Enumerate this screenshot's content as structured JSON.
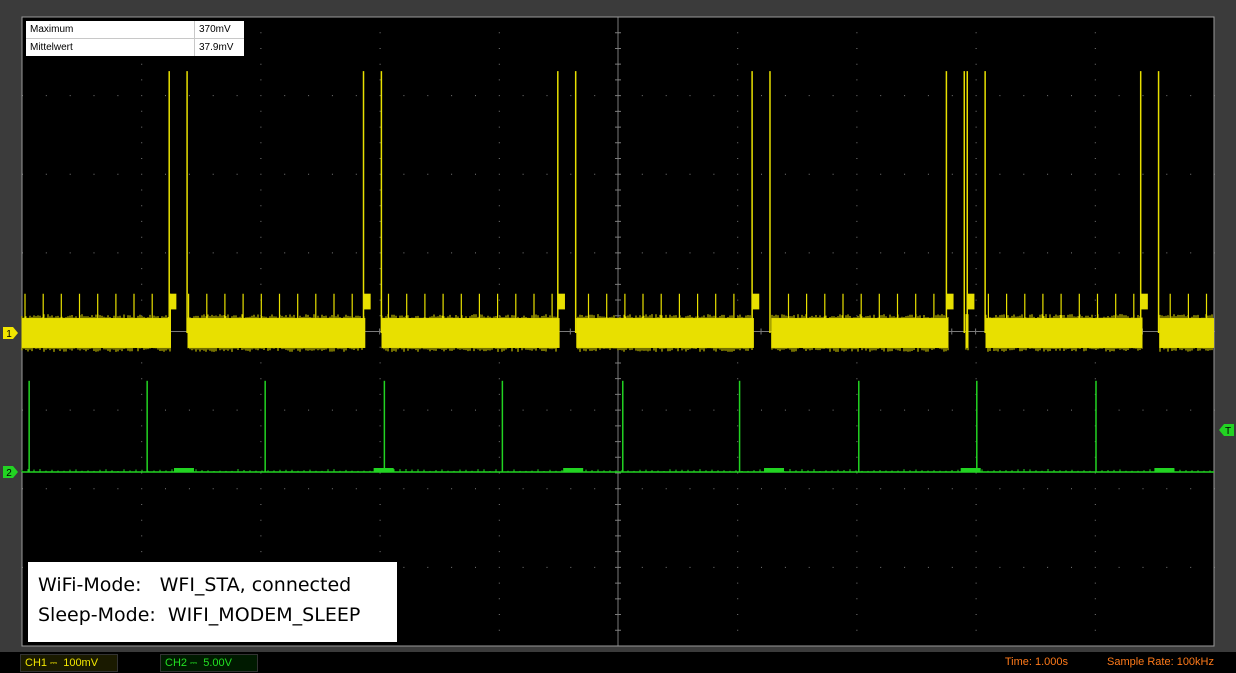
{
  "measurements": [
    {
      "label": "Maximum",
      "value": "370mV"
    },
    {
      "label": "Mittelwert",
      "value": "37.9mV"
    }
  ],
  "note": {
    "line1": "WiFi-Mode:   WFI_STA, connected",
    "line2": "Sleep-Mode:  WIFI_MODEM_SLEEP"
  },
  "status_bar": {
    "ch1_label": "CH1",
    "ch1_coupling": "⎓",
    "ch1_scale": "100mV",
    "ch2_label": "CH2",
    "ch2_coupling": "⎓",
    "ch2_scale": "5.00V",
    "time": "Time: 1.000s",
    "sample_rate": "Sample Rate: 100kHz"
  },
  "markers": {
    "ch1": "1",
    "ch2": "2",
    "trigger": "T"
  },
  "colors": {
    "ch1": "#e8e000",
    "ch2": "#22d322",
    "screen": "#000000",
    "grid": "#7a7a7a",
    "status_orange": "#ff7a1a"
  },
  "chart_data": {
    "type": "line",
    "grid_divisions": {
      "x": 10,
      "y": 8
    },
    "time_per_div_s": 1.0,
    "ch1_mV_per_div": 100,
    "ch2_V_per_div": 5.0,
    "series": [
      {
        "name": "CH1",
        "baseline_mV": 0,
        "noise_band_mV": [
          -19,
          19
        ],
        "small_peak_mV": 50,
        "burst_plateau_mV": 50,
        "burst_peak_mV": 370,
        "small_peak_period_s": 0.1,
        "bursts": [
          {
            "start_s": 2.47,
            "end_s": 2.77
          },
          {
            "start_s": 5.73,
            "end_s": 6.03
          },
          {
            "start_s": 8.99,
            "end_s": 9.29
          },
          {
            "start_s": 12.25,
            "end_s": 12.55
          },
          {
            "start_s": 15.51,
            "end_s": 15.81
          },
          {
            "start_s": 15.86,
            "end_s": 16.16
          },
          {
            "start_s": 18.77,
            "end_s": 19.07
          }
        ],
        "gaps": [
          {
            "start_s": 2.5,
            "end_s": 2.78
          },
          {
            "start_s": 5.76,
            "end_s": 6.04
          },
          {
            "start_s": 9.02,
            "end_s": 9.3
          },
          {
            "start_s": 12.28,
            "end_s": 12.57
          },
          {
            "start_s": 15.54,
            "end_s": 15.83
          },
          {
            "start_s": 15.88,
            "end_s": 16.17
          },
          {
            "start_s": 18.8,
            "end_s": 19.08
          }
        ]
      },
      {
        "name": "CH2",
        "baseline_V": 0,
        "spike_V": 5.8,
        "spikes_s": [
          0.12,
          2.1,
          4.08,
          6.08,
          8.06,
          10.08,
          12.04,
          14.04,
          16.02,
          18.02
        ],
        "small_bumps_s": [
          2.55,
          5.9,
          9.08,
          12.45,
          15.75,
          19.0
        ]
      }
    ]
  }
}
